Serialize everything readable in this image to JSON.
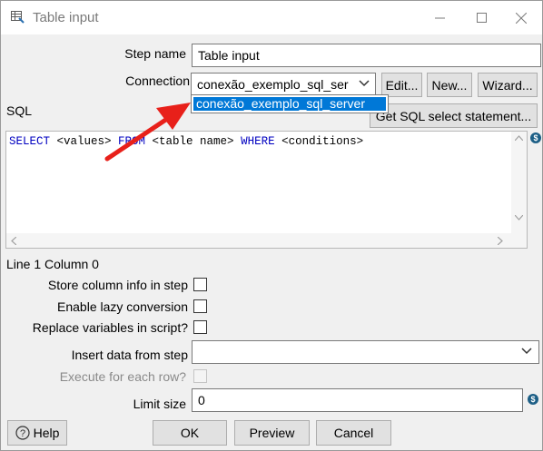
{
  "window": {
    "title": "Table input",
    "controls": {
      "minimize": "—",
      "maximize": "☐",
      "close": "✕"
    }
  },
  "form": {
    "step_name_label": "Step name",
    "step_name_value": "Table input",
    "connection_label": "Connection",
    "connection_value": "conexão_exemplo_sql_ser",
    "connection_options": [
      "conexão_exemplo_sql_server"
    ],
    "edit_button": "Edit...",
    "new_button": "New...",
    "wizard_button": "Wizard...",
    "sql_label": "SQL",
    "get_sql_button": "Get SQL select statement...",
    "sql_tokens": [
      {
        "t": "SELECT",
        "kw": true
      },
      {
        "t": " <values> ",
        "kw": false
      },
      {
        "t": "FROM",
        "kw": true
      },
      {
        "t": " <table name> ",
        "kw": false
      },
      {
        "t": "WHERE",
        "kw": true
      },
      {
        "t": " <conditions>",
        "kw": false
      }
    ],
    "cursor_position": "Line 1 Column 0",
    "store_column_info_label": "Store column info in step",
    "store_column_info_checked": false,
    "lazy_conversion_label": "Enable lazy conversion",
    "lazy_conversion_checked": false,
    "replace_variables_label": "Replace variables in script?",
    "replace_variables_checked": false,
    "insert_data_label": "Insert data from step",
    "insert_data_value": "",
    "execute_each_row_label": "Execute for each row?",
    "execute_each_row_checked": false,
    "limit_size_label": "Limit size",
    "limit_size_value": "0"
  },
  "footer": {
    "help_button": "Help",
    "ok_button": "OK",
    "preview_button": "Preview",
    "cancel_button": "Cancel"
  },
  "annotation": {
    "arrow_color": "#e8201a"
  },
  "colors": {
    "selection": "#0078d7",
    "sql_keyword": "#0000c0"
  }
}
